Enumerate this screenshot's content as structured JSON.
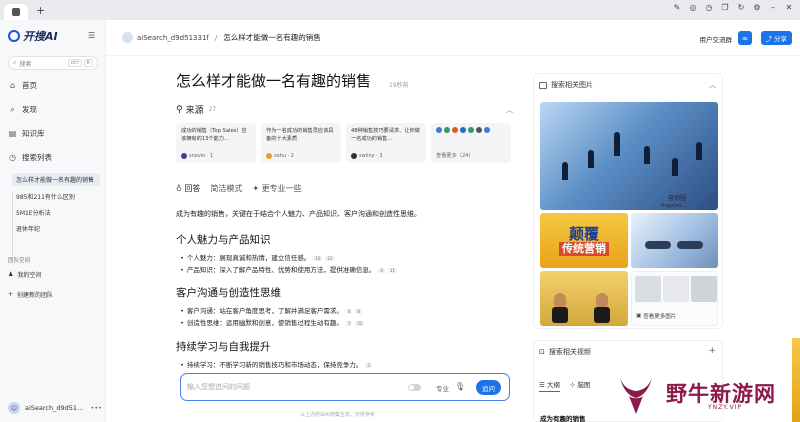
{
  "browser": {
    "new_tab": "+",
    "toolbar_icons": [
      "pin-icon",
      "compass-icon",
      "clock-icon",
      "copy-icon",
      "refresh-icon",
      "settings-icon",
      "minimize-icon",
      "close-icon"
    ]
  },
  "sidebar": {
    "logo": "开搜AI",
    "search": {
      "placeholder": "搜索",
      "kbd": [
        "ctrl",
        "K"
      ]
    },
    "nav": [
      {
        "label": "首页",
        "icon": "home-icon"
      },
      {
        "label": "发现",
        "icon": "search-icon"
      },
      {
        "label": "知识库",
        "icon": "book-icon"
      },
      {
        "label": "搜索列表",
        "icon": "clock-icon"
      }
    ],
    "history": [
      "怎么样才能做一名有趣的销售",
      "985和211有什么区别",
      "5M1E分析法",
      "退休年纪"
    ],
    "team_section": "团队空间",
    "my_space": "我的空间",
    "create_team": "创建新的团队",
    "user": "aiSearch_d9d51..."
  },
  "header": {
    "user": "aiSearch_d9d51331f",
    "separator": "/",
    "title": "怎么样才能做一名有趣的销售",
    "group": "用户交流群",
    "share": "分享"
  },
  "main": {
    "question": "怎么样才能做一名有趣的销售",
    "time": "19秒前",
    "sources_label": "来源",
    "sources_count": "27",
    "sources": [
      {
        "text": "成功的销售（Top Sales）应该拥有的13个能力...",
        "site": "snovio · 1",
        "color": "#4a3c8c"
      },
      {
        "text": "作为一名成功的销售员应该具备的十大素质",
        "site": "sohu · 2",
        "color": "#e8a020"
      },
      {
        "text": "48种销售技巧要请求、让你做一名成功的销售...",
        "site": "swiiny · 3",
        "color": "#333333"
      }
    ],
    "more_sources": "查看更多（24）",
    "tabs": [
      "回答",
      "简洁模式",
      "更专业一些"
    ],
    "intro": "成为有趣的销售，关键在于结合个人魅力、产品知识、客户沟通和创造性思维。",
    "sections": [
      {
        "title": "个人魅力与产品知识",
        "bullets": [
          {
            "text": "个人魅力：展现真诚和热情，建立信任感。",
            "cites": [
              "10",
              "21"
            ]
          },
          {
            "text": "产品知识：深入了解产品特性、优势和使用方法，提供准确信息。",
            "cites": [
              "4",
              "11"
            ]
          }
        ]
      },
      {
        "title": "客户沟通与创造性思维",
        "bullets": [
          {
            "text": "客户沟通：站在客户角度思考，了解并满足客户需求。",
            "cites": [
              "4",
              "8"
            ]
          },
          {
            "text": "创造性思维：运用幽默和创意，使销售过程生动有趣。",
            "cites": [
              "7",
              "22"
            ]
          }
        ]
      },
      {
        "title": "持续学习与自我提升",
        "bullets": [
          {
            "text": "持续学习：不断学习新的销售技巧和市场动态，保持竞争力。",
            "cites": [
              "3"
            ]
          }
        ]
      }
    ],
    "ask": {
      "placeholder": "输入您想追问的问题",
      "pro": "专业",
      "send": "追问"
    },
    "footnote": "以上内容由AI搜集生成，仅供参考"
  },
  "right": {
    "images_title": "搜索相关图片",
    "image1_watermark": "营销圈",
    "image1_watermark_sub": "Yingxiao...",
    "image2_line1": "颠覆",
    "image2_line2": "传统营销",
    "more_images": "查看更多图片",
    "videos_title": "搜索相关视频",
    "video_tabs": [
      "大纲",
      "脑图"
    ],
    "video_subtitle": "成为有趣的销售"
  },
  "watermark": {
    "name": "野牛新游网",
    "url": "YNZY.VIP"
  }
}
